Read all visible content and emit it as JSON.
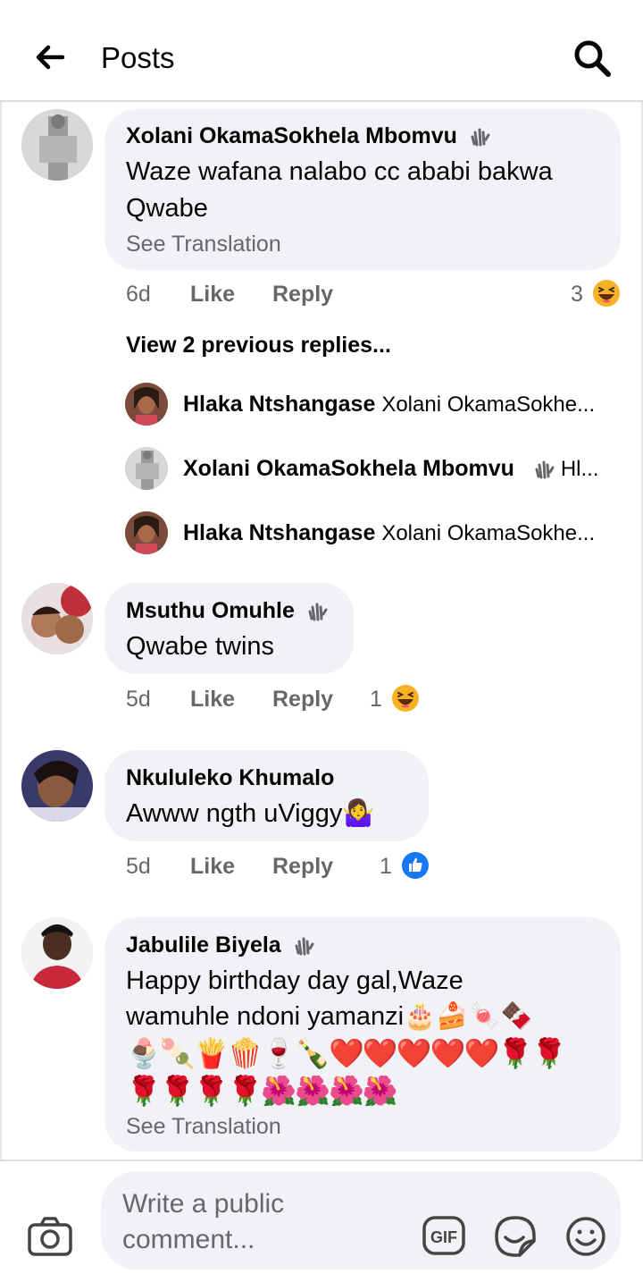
{
  "header": {
    "title": "Posts"
  },
  "comments": [
    {
      "author": "Xolani OkamaSokhela Mbomvu",
      "text_line1": "Waze wafana nalabo cc ababi bakwa",
      "text_line2": "Qwabe",
      "see_translation": "See Translation",
      "time": "6d",
      "like": "Like",
      "reply": "Reply",
      "reaction_count": "3",
      "reaction": "haha"
    },
    {
      "author": "Msuthu Omuhle",
      "text_line1": "Qwabe twins",
      "time": "5d",
      "like": "Like",
      "reply": "Reply",
      "reaction_count": "1",
      "reaction": "haha"
    },
    {
      "author": "Nkululeko Khumalo",
      "text_line1": "Awww ngth uViggy🤷‍♀️",
      "time": "5d",
      "like": "Like",
      "reply": "Reply",
      "reaction_count": "1",
      "reaction": "like"
    },
    {
      "author": "Jabulile Biyela",
      "text_line1": "Happy birthday day gal,Waze",
      "text_line2": "wamuhle ndoni yamanzi🎂🍰🍬🍫",
      "emoji_line1": "🍨🍡🍟🍿🍷🍾❤️❤️❤️❤️❤️🌹🌹",
      "emoji_line2": "🌹🌹🌹🌹🌺🌺🌺🌺",
      "see_translation": "See Translation"
    }
  ],
  "replies": {
    "view_previous": "View 2 previous replies...",
    "items": [
      {
        "author": "Hlaka Ntshangase",
        "snippet": "Xolani OkamaSokhe..."
      },
      {
        "author": "Xolani OkamaSokhela Mbomvu",
        "snippet": "Hl..."
      },
      {
        "author": "Hlaka Ntshangase",
        "snippet": "Xolani OkamaSokhe..."
      }
    ]
  },
  "composer": {
    "placeholder": "Write a public comment..."
  },
  "icons": {
    "back": "arrow-left-icon",
    "search": "search-icon",
    "wave": "wave-hand-icon",
    "haha": "haha-reaction-icon",
    "like": "like-reaction-icon",
    "camera": "camera-icon",
    "gif": "gif-icon",
    "sticker": "sticker-icon",
    "emoji": "smiley-icon"
  },
  "colors": {
    "bubble": "#f0f2f5",
    "secondary_text": "#65676b",
    "like_blue": "#1877f2"
  }
}
